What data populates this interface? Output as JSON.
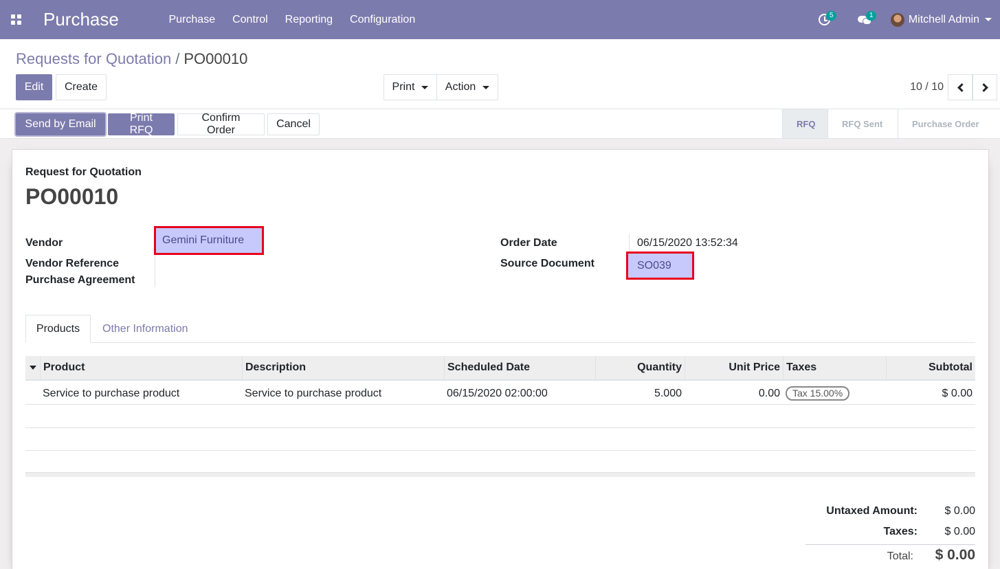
{
  "navbar": {
    "app_name": "Purchase",
    "menu": [
      "Purchase",
      "Control",
      "Reporting",
      "Configuration"
    ],
    "activity_count": "5",
    "message_count": "1",
    "user_name": "Mitchell Admin"
  },
  "breadcrumb": {
    "parent": "Requests for Quotation",
    "separator": "/",
    "current": "PO00010"
  },
  "buttons": {
    "edit": "Edit",
    "create": "Create",
    "print": "Print",
    "action": "Action"
  },
  "pager": {
    "value": "10 / 10"
  },
  "statusbar": {
    "send_email": "Send by Email",
    "print_rfq": "Print RFQ",
    "confirm_order": "Confirm Order",
    "cancel": "Cancel",
    "stages": [
      "RFQ",
      "RFQ Sent",
      "Purchase Order"
    ],
    "active_stage": "RFQ"
  },
  "form": {
    "subtitle": "Request for Quotation",
    "name": "PO00010",
    "vendor_label": "Vendor",
    "vendor_value": "Gemini Furniture",
    "vendor_ref_label": "Vendor Reference",
    "agreement_label": "Purchase Agreement",
    "order_date_label": "Order Date",
    "order_date_value": "06/15/2020 13:52:34",
    "source_doc_label": "Source Document",
    "source_doc_value": "SO039"
  },
  "tabs": [
    "Products",
    "Other Information"
  ],
  "table": {
    "headers": [
      "Product",
      "Description",
      "Scheduled Date",
      "Quantity",
      "Unit Price",
      "Taxes",
      "Subtotal"
    ],
    "rows": [
      {
        "product": "Service to purchase product",
        "description": "Service to purchase product",
        "scheduled_date": "06/15/2020 02:00:00",
        "quantity": "5.000",
        "unit_price": "0.00",
        "taxes": "Tax 15.00%",
        "subtotal": "$ 0.00"
      }
    ]
  },
  "totals": {
    "untaxed_label": "Untaxed Amount:",
    "untaxed_value": "$ 0.00",
    "taxes_label": "Taxes:",
    "taxes_value": "$ 0.00",
    "total_label": "Total:",
    "total_value": "$ 0.00"
  },
  "colors": {
    "brand": "#7c7bad",
    "highlight_border": "#e8001c",
    "highlight_fill": "#c7c9fc"
  }
}
